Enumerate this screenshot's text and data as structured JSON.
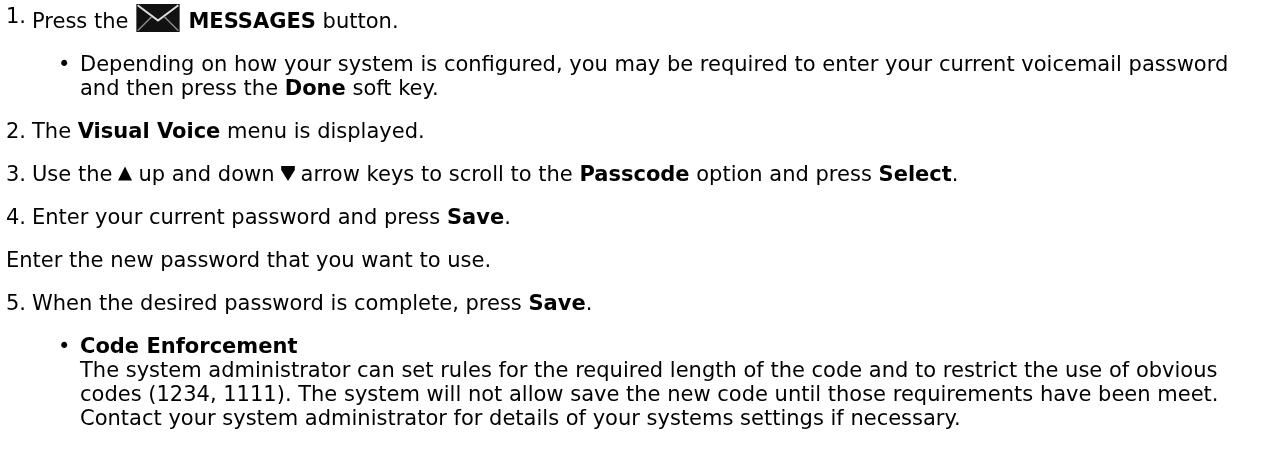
{
  "steps": [
    {
      "kind": "step",
      "number": "1.",
      "parts": [
        {
          "kind": "text",
          "text": "Press the"
        },
        {
          "kind": "envelope"
        },
        {
          "kind": "text",
          "text": "**MESSAGES** button."
        }
      ],
      "bullets": [
        {
          "marker": "•",
          "text": "Depending on how your system is configured, you may be required to enter your current voicemail password and then press the **Done** soft key."
        }
      ]
    },
    {
      "kind": "step",
      "number": "2.",
      "parts": [
        {
          "kind": "text",
          "text": "The **Visual Voice** menu is displayed."
        }
      ]
    },
    {
      "kind": "step",
      "number": "3.",
      "parts": [
        {
          "kind": "text",
          "text": "Use the"
        },
        {
          "kind": "up"
        },
        {
          "kind": "text",
          "text": "up and down"
        },
        {
          "kind": "down"
        },
        {
          "kind": "text",
          "text": "arrow keys to scroll to the **Passcode** option and press **Select**."
        }
      ]
    },
    {
      "kind": "step",
      "number": "4.",
      "parts": [
        {
          "kind": "text",
          "text": "Enter your current password and press **Save**."
        }
      ]
    },
    {
      "kind": "plain",
      "parts": [
        {
          "kind": "text",
          "text": "Enter the new password that you want to use."
        }
      ]
    },
    {
      "kind": "step",
      "number": "5.",
      "parts": [
        {
          "kind": "text",
          "text": "When the desired password is complete, press **Save**."
        }
      ],
      "bullets": [
        {
          "marker": "•",
          "title": "Code Enforcement",
          "text": "The system administrator can set rules for the required length of the code and to restrict the use of obvious codes (1234, 1111). The system will not allow save the new code until those requirements have been meet. Contact your system administrator for details of your systems settings if necessary."
        }
      ]
    }
  ]
}
